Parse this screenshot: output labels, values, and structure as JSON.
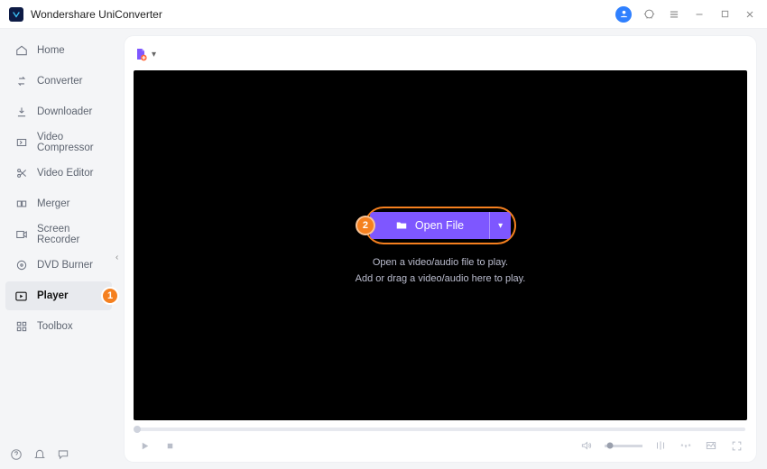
{
  "app": {
    "title": "Wondershare UniConverter"
  },
  "annotations": {
    "step1": "1",
    "step2": "2"
  },
  "sidebar": {
    "items": [
      {
        "label": "Home",
        "icon": "home-icon"
      },
      {
        "label": "Converter",
        "icon": "convert-icon"
      },
      {
        "label": "Downloader",
        "icon": "download-icon"
      },
      {
        "label": "Video Compressor",
        "icon": "compress-icon"
      },
      {
        "label": "Video Editor",
        "icon": "scissors-icon"
      },
      {
        "label": "Merger",
        "icon": "merge-icon"
      },
      {
        "label": "Screen Recorder",
        "icon": "record-icon"
      },
      {
        "label": "DVD Burner",
        "icon": "disc-icon"
      },
      {
        "label": "Player",
        "icon": "play-icon",
        "active": true
      },
      {
        "label": "Toolbox",
        "icon": "grid-icon"
      }
    ]
  },
  "player": {
    "open_label": "Open File",
    "hint1": "Open a video/audio file to play.",
    "hint2": "Add or drag a video/audio here to play."
  }
}
